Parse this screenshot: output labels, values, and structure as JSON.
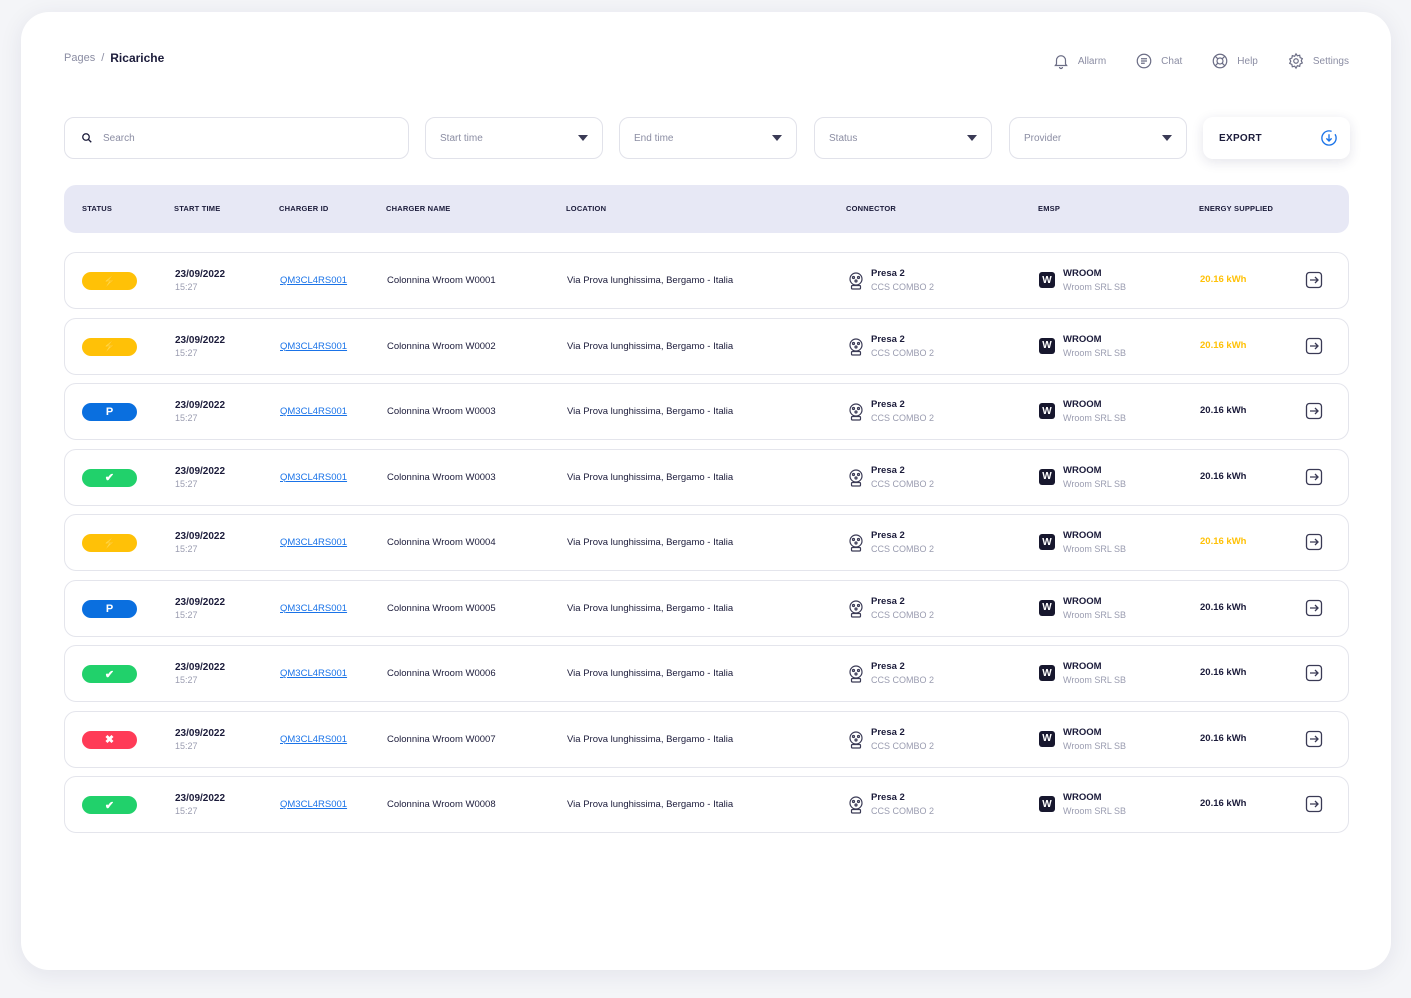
{
  "breadcrumb": {
    "parent": "Pages",
    "separator": "/",
    "current": "Ricariche"
  },
  "topnav": [
    {
      "label": "Allarm",
      "icon": "bell-icon"
    },
    {
      "label": "Chat",
      "icon": "chat-icon"
    },
    {
      "label": "Help",
      "icon": "lifebuoy-icon"
    },
    {
      "label": "Settings",
      "icon": "gear-icon"
    }
  ],
  "filters": {
    "search_placeholder": "Search",
    "start_time": "Start time",
    "end_time": "End time",
    "status": "Status",
    "provider": "Provider",
    "export_label": "EXPORT"
  },
  "columns": {
    "status": "STATUS",
    "start_time": "START TIME",
    "charger_id": "CHARGER ID",
    "charger_name": "CHARGER NAME",
    "location": "LOCATION",
    "connector": "CONNECTOR",
    "emsp": "EMSP",
    "energy": "ENERGY SUPPLIED"
  },
  "colors": {
    "charging": "#ffc107",
    "parked": "#0a6fdf",
    "completed": "#21d16b",
    "error": "#ff3b57"
  },
  "rows": [
    {
      "status": "charging",
      "status_glyph": "⚡",
      "date": "23/09/2022",
      "time": "15:27",
      "charger_id": "QM3CL4RS001",
      "charger_name": "Colonnina Wroom W0001",
      "location": "Via Prova lunghissima, Bergamo - Italia",
      "connector_name": "Presa 2",
      "connector_type": "CCS COMBO 2",
      "emsp_logo": "W",
      "emsp_name": "WROOM",
      "emsp_sub": "Wroom SRL SB",
      "energy": "20.16 kWh"
    },
    {
      "status": "charging",
      "status_glyph": "⚡",
      "date": "23/09/2022",
      "time": "15:27",
      "charger_id": "QM3CL4RS001",
      "charger_name": "Colonnina Wroom W0002",
      "location": "Via Prova lunghissima, Bergamo - Italia",
      "connector_name": "Presa 2",
      "connector_type": "CCS COMBO 2",
      "emsp_logo": "W",
      "emsp_name": "WROOM",
      "emsp_sub": "Wroom SRL SB",
      "energy": "20.16 kWh"
    },
    {
      "status": "parked",
      "status_glyph": "P",
      "date": "23/09/2022",
      "time": "15:27",
      "charger_id": "QM3CL4RS001",
      "charger_name": "Colonnina Wroom W0003",
      "location": "Via Prova lunghissima, Bergamo - Italia",
      "connector_name": "Presa 2",
      "connector_type": "CCS COMBO 2",
      "emsp_logo": "W",
      "emsp_name": "WROOM",
      "emsp_sub": "Wroom SRL SB",
      "energy": "20.16 kWh"
    },
    {
      "status": "completed",
      "status_glyph": "✔",
      "date": "23/09/2022",
      "time": "15:27",
      "charger_id": "QM3CL4RS001",
      "charger_name": "Colonnina Wroom W0003",
      "location": "Via Prova lunghissima, Bergamo - Italia",
      "connector_name": "Presa 2",
      "connector_type": "CCS COMBO 2",
      "emsp_logo": "W",
      "emsp_name": "WROOM",
      "emsp_sub": "Wroom SRL SB",
      "energy": "20.16 kWh"
    },
    {
      "status": "charging",
      "status_glyph": "⚡",
      "date": "23/09/2022",
      "time": "15:27",
      "charger_id": "QM3CL4RS001",
      "charger_name": "Colonnina Wroom W0004",
      "location": "Via Prova lunghissima, Bergamo - Italia",
      "connector_name": "Presa 2",
      "connector_type": "CCS COMBO 2",
      "emsp_logo": "W",
      "emsp_name": "WROOM",
      "emsp_sub": "Wroom SRL SB",
      "energy": "20.16 kWh"
    },
    {
      "status": "parked",
      "status_glyph": "P",
      "date": "23/09/2022",
      "time": "15:27",
      "charger_id": "QM3CL4RS001",
      "charger_name": "Colonnina Wroom W0005",
      "location": "Via Prova lunghissima, Bergamo - Italia",
      "connector_name": "Presa 2",
      "connector_type": "CCS COMBO 2",
      "emsp_logo": "W",
      "emsp_name": "WROOM",
      "emsp_sub": "Wroom SRL SB",
      "energy": "20.16 kWh"
    },
    {
      "status": "completed",
      "status_glyph": "✔",
      "date": "23/09/2022",
      "time": "15:27",
      "charger_id": "QM3CL4RS001",
      "charger_name": "Colonnina Wroom W0006",
      "location": "Via Prova lunghissima, Bergamo - Italia",
      "connector_name": "Presa 2",
      "connector_type": "CCS COMBO 2",
      "emsp_logo": "W",
      "emsp_name": "WROOM",
      "emsp_sub": "Wroom SRL SB",
      "energy": "20.16 kWh"
    },
    {
      "status": "error",
      "status_glyph": "✖",
      "date": "23/09/2022",
      "time": "15:27",
      "charger_id": "QM3CL4RS001",
      "charger_name": "Colonnina Wroom W0007",
      "location": "Via Prova lunghissima, Bergamo - Italia",
      "connector_name": "Presa 2",
      "connector_type": "CCS COMBO 2",
      "emsp_logo": "W",
      "emsp_name": "WROOM",
      "emsp_sub": "Wroom SRL SB",
      "energy": "20.16 kWh"
    },
    {
      "status": "completed",
      "status_glyph": "✔",
      "date": "23/09/2022",
      "time": "15:27",
      "charger_id": "QM3CL4RS001",
      "charger_name": "Colonnina Wroom W0008",
      "location": "Via Prova lunghissima, Bergamo - Italia",
      "connector_name": "Presa 2",
      "connector_type": "CCS COMBO 2",
      "emsp_logo": "W",
      "emsp_name": "WROOM",
      "emsp_sub": "Wroom SRL SB",
      "energy": "20.16 kWh"
    }
  ]
}
